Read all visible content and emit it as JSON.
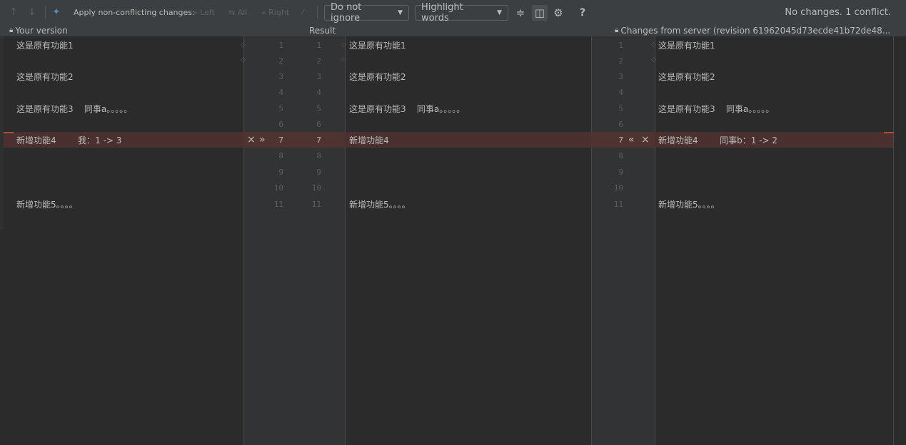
{
  "toolbar": {
    "apply_label": "Apply non-conflicting changes:",
    "left_label": "Left",
    "all_label": "All",
    "right_label": "Right",
    "ignore_select": "Do not ignore",
    "highlight_select": "Highlight words",
    "help_label": "?",
    "status": "No changes. 1 conflict."
  },
  "headers": {
    "left": "Your version",
    "center": "Result",
    "right": "Changes from server (revision 61962045d73ecde41b72de48..."
  },
  "left_lines": [
    {
      "text": "这是原有功能1"
    },
    {
      "text": "这是原有功能2"
    },
    {
      "text": "这是原有功能3    同事a。。。。。"
    },
    {
      "text": "新增功能4        我：1 -> 3"
    },
    {
      "text": "新增功能5。。。。"
    }
  ],
  "center_lines": [
    {
      "text": "这是原有功能1"
    },
    {
      "text": "这是原有功能2"
    },
    {
      "text": "这是原有功能3    同事a。。。。。"
    },
    {
      "text": "新增功能4"
    },
    {
      "text": "新增功能5。。。。"
    }
  ],
  "right_lines": [
    {
      "text": "这是原有功能1"
    },
    {
      "text": "这是原有功能2"
    },
    {
      "text": "这是原有功能3    同事a。。。。。"
    },
    {
      "text": "新增功能4        同事b：1 -> 2"
    },
    {
      "text": "新增功能5。。。。"
    }
  ],
  "line_numbers": [
    "1",
    "2",
    "3",
    "4",
    "5",
    "6",
    "7",
    "8",
    "9",
    "10",
    "11"
  ],
  "conflict": {
    "line": "7",
    "accept_left": "»",
    "accept_right": "«",
    "ignore": "×"
  },
  "colors": {
    "conflict_bg": "#4a302f",
    "accent": "#4a88c7"
  },
  "icons": [
    "prev-diff-icon",
    "next-diff-icon",
    "magic-resolve-icon",
    "collapse-unchanged-icon",
    "sync-scroll-icon",
    "settings-icon",
    "lock-icon"
  ]
}
